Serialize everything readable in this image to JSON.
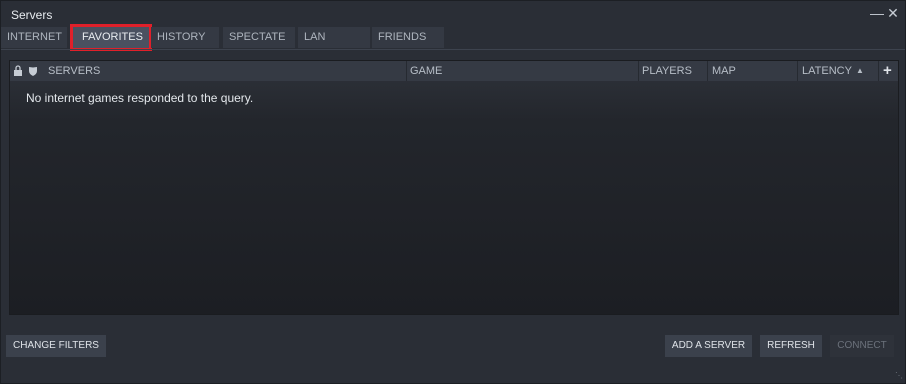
{
  "window": {
    "title": "Servers",
    "minimize_icon": "minimize-icon",
    "close_icon": "close-icon"
  },
  "tabs": [
    {
      "label": "INTERNET",
      "active": false
    },
    {
      "label": "FAVORITES",
      "active": true
    },
    {
      "label": "HISTORY",
      "active": false
    },
    {
      "label": "SPECTATE",
      "active": false
    },
    {
      "label": "LAN",
      "active": false
    },
    {
      "label": "FRIENDS",
      "active": false
    }
  ],
  "table": {
    "columns": {
      "lock_icon": "lock-icon",
      "shield_icon": "shield-icon",
      "servers": "SERVERS",
      "game": "GAME",
      "players": "PLAYERS",
      "map": "MAP",
      "latency": "LATENCY",
      "sort_icon": "sort-ascending-icon",
      "add_column_icon": "plus-icon"
    },
    "empty_message": "No internet games responded to the query."
  },
  "buttons": {
    "change_filters": "CHANGE FILTERS",
    "add_server": "ADD A SERVER",
    "refresh": "REFRESH",
    "connect": "CONNECT"
  },
  "colors": {
    "highlight": "#e0202a"
  }
}
